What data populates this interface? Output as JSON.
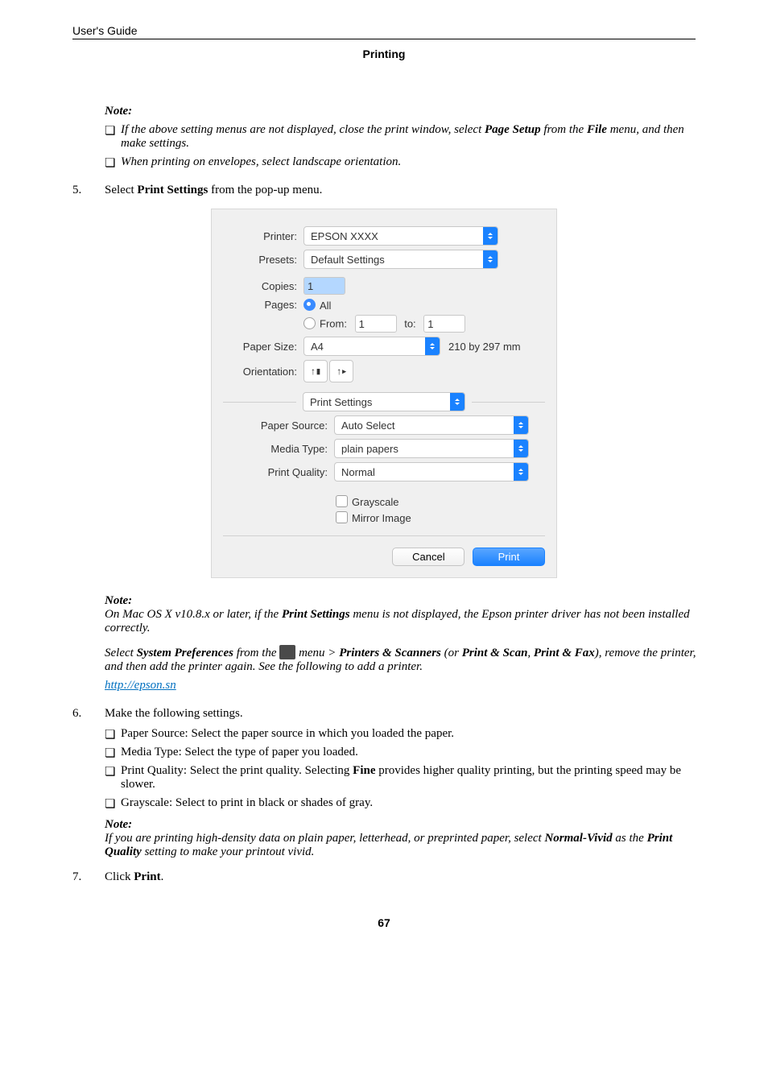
{
  "header": {
    "guide": "User's Guide",
    "section": "Printing"
  },
  "note1": {
    "label": "Note:",
    "items": [
      {
        "pre": "If the above setting menus are not displayed, close the print window, select ",
        "bi1": "Page Setup",
        "mid": " from the ",
        "bi2": "File",
        "post": " menu, and then make settings."
      },
      {
        "text": "When printing on envelopes, select landscape orientation."
      }
    ]
  },
  "step5": {
    "num": "5.",
    "pre": "Select ",
    "bold": "Print Settings",
    "post": " from the pop-up menu."
  },
  "dialog": {
    "labels": {
      "printer": "Printer:",
      "presets": "Presets:",
      "copies": "Copies:",
      "pages": "Pages:",
      "all": "All",
      "from": "From:",
      "to": "to:",
      "paperSize": "Paper Size:",
      "orientation": "Orientation:",
      "sectionDD": "Print Settings",
      "paperSource": "Paper Source:",
      "mediaType": "Media Type:",
      "printQuality": "Print Quality:",
      "grayscale": "Grayscale",
      "mirror": "Mirror Image"
    },
    "values": {
      "printer": "EPSON XXXX",
      "presets": "Default Settings",
      "copies": "1",
      "from": "1",
      "to": "1",
      "paperSize": "A4",
      "paperDim": "210 by 297 mm",
      "paperSource": "Auto Select",
      "mediaType": "plain papers",
      "printQuality": "Normal"
    },
    "buttons": {
      "cancel": "Cancel",
      "print": "Print"
    }
  },
  "note2": {
    "label": "Note:",
    "line1_pre": "On Mac OS X v10.8.x or later, if the ",
    "line1_bi": "Print Settings",
    "line1_post": " menu is not displayed, the Epson printer driver has not been installed correctly.",
    "line2_pre": "Select ",
    "line2_bi1": "System Preferences",
    "line2_mid1": " from the ",
    "line2_mid2": " menu > ",
    "line2_bi2": "Printers & Scanners",
    "line2_or": " (or ",
    "line2_bi3": "Print & Scan",
    "line2_comma": ", ",
    "line2_bi4": "Print & Fax",
    "line2_post": "), remove the printer, and then add the printer again. See the following to add a printer.",
    "link": "http://epson.sn"
  },
  "step6": {
    "num": "6.",
    "lead": "Make the following settings.",
    "items": {
      "a": "Paper Source: Select the paper source in which you loaded the paper.",
      "b": "Media Type: Select the type of paper you loaded.",
      "c_pre": "Print Quality: Select the print quality. Selecting ",
      "c_bold": "Fine",
      "c_post": " provides higher quality printing, but the printing speed may be slower.",
      "d": "Grayscale: Select to print in black or shades of gray."
    },
    "subnote": {
      "label": "Note:",
      "pre": "If you are printing high-density data on plain paper, letterhead, or preprinted paper, select ",
      "bi1": "Normal-Vivid",
      "mid": " as the ",
      "bi2": "Print Quality",
      "post": " setting to make your printout vivid."
    }
  },
  "step7": {
    "num": "7.",
    "pre": "Click ",
    "bold": "Print",
    "post": "."
  },
  "pageNum": "67"
}
